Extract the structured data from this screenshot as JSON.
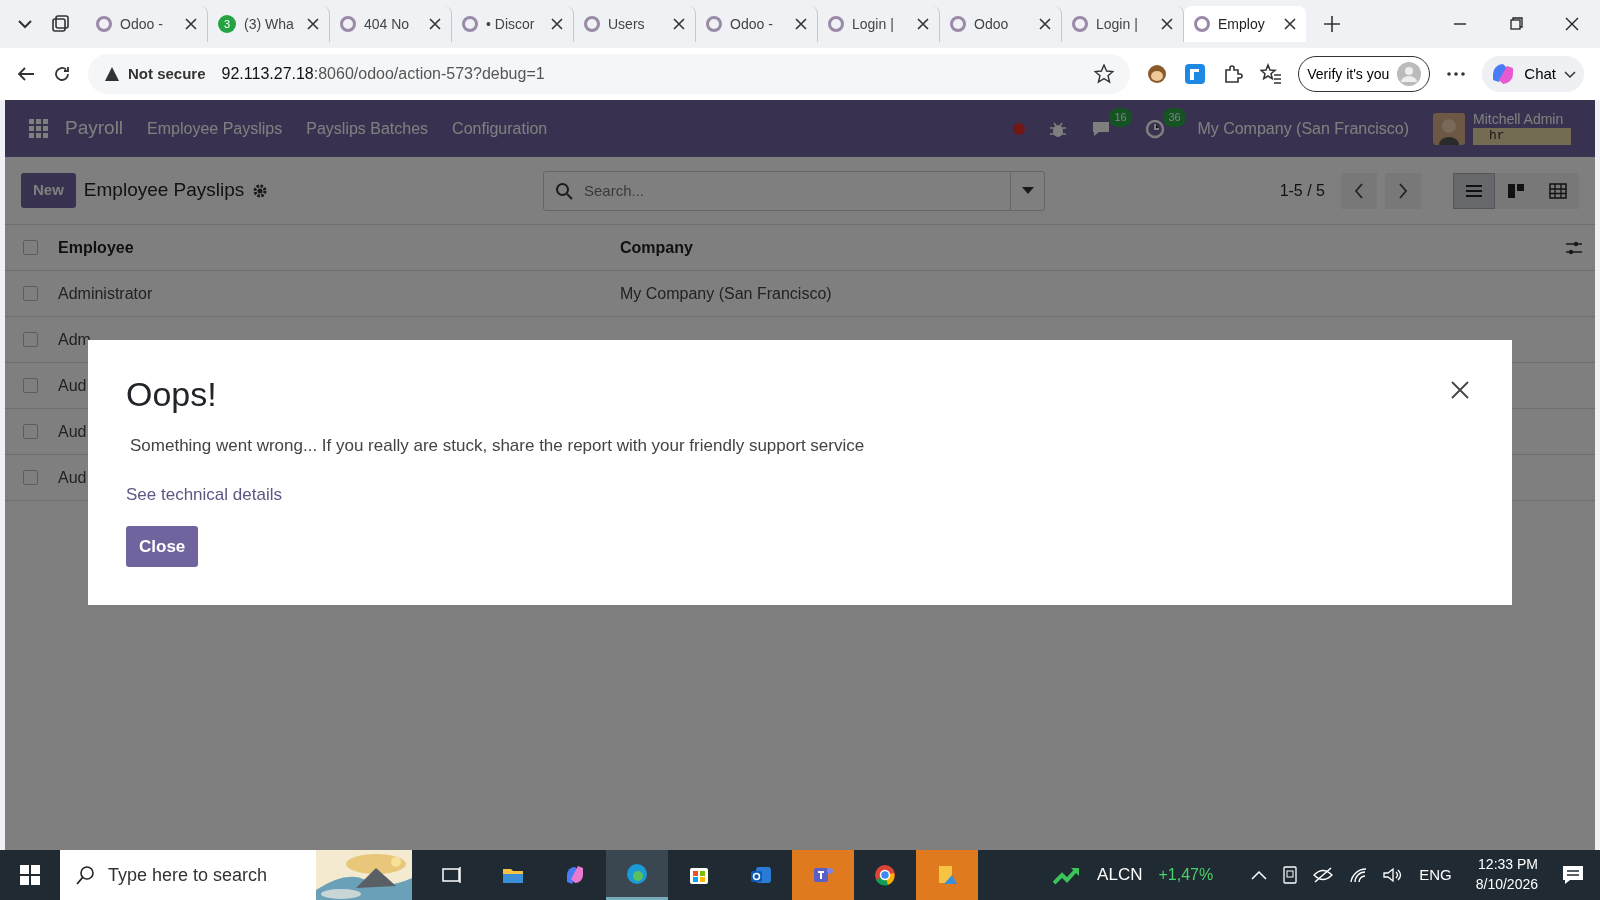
{
  "browser": {
    "tabs": [
      {
        "title": "Odoo -",
        "selected": false
      },
      {
        "title": "(3) Wha",
        "selected": false,
        "badge": "3"
      },
      {
        "title": "404 No",
        "selected": false
      },
      {
        "title": "• Discor",
        "selected": false
      },
      {
        "title": "Users",
        "selected": false
      },
      {
        "title": "Odoo -",
        "selected": false
      },
      {
        "title": "Login | ",
        "selected": false
      },
      {
        "title": "Odoo",
        "selected": false
      },
      {
        "title": "Login | ",
        "selected": false
      },
      {
        "title": "Employ",
        "selected": true
      }
    ],
    "security": "Not secure",
    "url_host": "92.113.27.18",
    "url_rest": ":8060/odoo/action-573?debug=1",
    "verify": "Verify it's you",
    "chat": "Chat"
  },
  "navbar": {
    "app": "Payroll",
    "menus": [
      "Employee Payslips",
      "Payslips Batches",
      "Configuration"
    ],
    "messages_count": "16",
    "activities_count": "36",
    "company": "My Company (San Francisco)",
    "user": "Mitchell Admin",
    "database": "hr"
  },
  "control_panel": {
    "new_button": "New",
    "title": "Employee Payslips",
    "search": {
      "placeholder": "Search..."
    },
    "pager": "1-5 / 5",
    "views": [
      {
        "kind": "list",
        "selected": true
      },
      {
        "kind": "kanban",
        "selected": false
      },
      {
        "kind": "grid",
        "selected": false
      }
    ]
  },
  "table": {
    "select_all_checked": false,
    "columns": [
      "Employee",
      "Company"
    ],
    "rows": [
      {
        "checked": false,
        "employee": "Administrator",
        "company": "My Company (San Francisco)"
      },
      {
        "checked": false,
        "employee": "Adm"
      },
      {
        "checked": false,
        "employee": "Aud"
      },
      {
        "checked": false,
        "employee": "Aud"
      },
      {
        "checked": false,
        "employee": "Aud"
      }
    ]
  },
  "dialog": {
    "title": "Oops!",
    "message": "Something went wrong... If you really are stuck, share the report with your friendly support service",
    "details_link": "See technical details",
    "close_button": "Close"
  },
  "taskbar": {
    "search_placeholder": "Type here to search",
    "stock_symbol": "ALCN",
    "stock_change": "+1,47%",
    "language": "ENG",
    "time": "12:33 PM",
    "date": "8/10/2026"
  }
}
